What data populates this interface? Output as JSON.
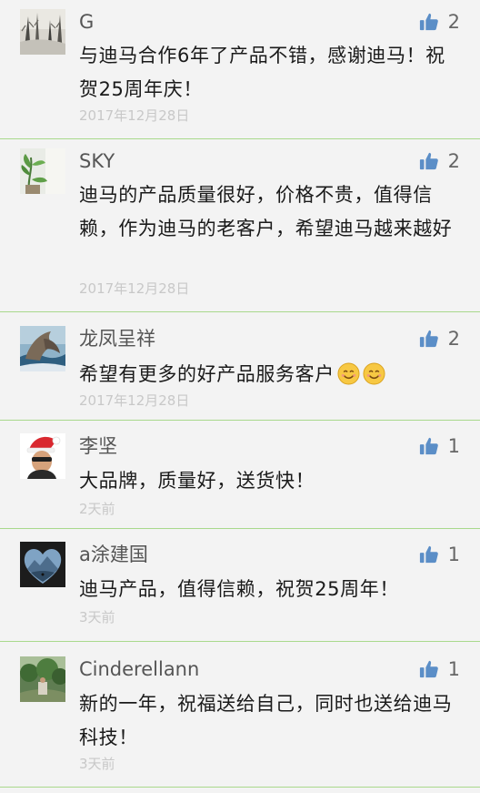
{
  "comments": [
    {
      "name": "G",
      "like_count": "2",
      "text": "与迪马合作6年了产品不错，感谢迪马！祝贺25周年庆！",
      "date": "2017年12月28日",
      "avatar": "avatar-snowy-forest"
    },
    {
      "name": "SKY",
      "like_count": "2",
      "text": "迪马的产品质量很好，价格不贵，值得信赖，作为迪马的老客户，希望迪马越来越好",
      "date": "2017年12月28日",
      "avatar": "avatar-plant-window"
    },
    {
      "name": "龙凤呈祥",
      "like_count": "2",
      "text": "希望有更多的好产品服务客户",
      "emojis": [
        "smile-emoji",
        "smile-emoji"
      ],
      "date": "2017年12月28日",
      "avatar": "avatar-dolphin-sculpture"
    },
    {
      "name": "李坚",
      "like_count": "1",
      "text": "大品牌，质量好，送货快！",
      "date": "2天前",
      "avatar": "avatar-man-santa-hat"
    },
    {
      "name": "a涂建国",
      "like_count": "1",
      "text": "迪马产品，值得信赖，祝贺25周年！",
      "date": "3天前",
      "avatar": "avatar-heart-landscape"
    },
    {
      "name": "Cinderellann",
      "like_count": "1",
      "text": "新的一年，祝福送给自己，同时也送给迪马科技！",
      "date": "3天前",
      "avatar": "avatar-green-garden"
    }
  ],
  "colors": {
    "background": "#f3f3f3",
    "divider": "#a9d98c",
    "like_icon": "#5b8ec7",
    "name_text": "#555555",
    "body_text": "#1a1a1a",
    "date_text": "#c8c8c8"
  },
  "icons": {
    "like": "thumbs-up-icon"
  }
}
